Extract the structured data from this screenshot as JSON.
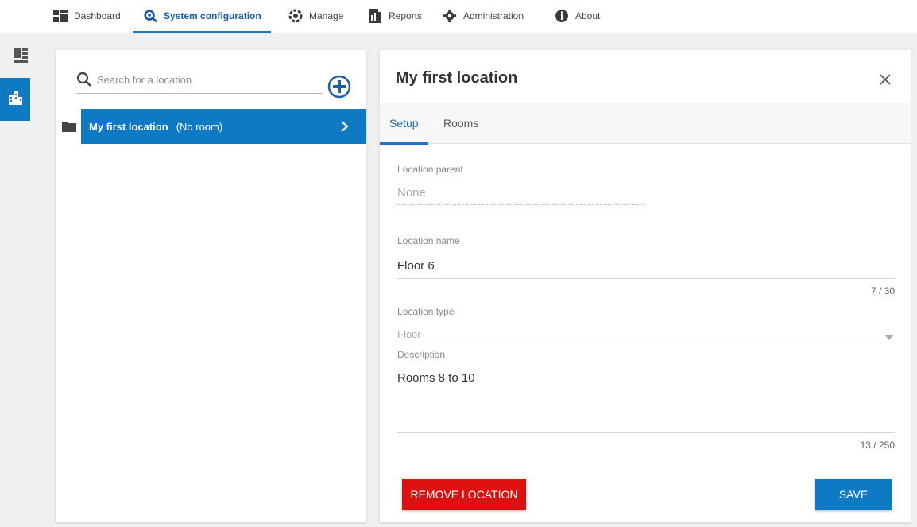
{
  "nav": {
    "items": [
      {
        "label": "Dashboard",
        "icon": "dashboard-icon"
      },
      {
        "label": "System configuration",
        "icon": "system-configuration-icon"
      },
      {
        "label": "Manage",
        "icon": "manage-icon"
      },
      {
        "label": "Reports",
        "icon": "reports-icon"
      },
      {
        "label": "Administration",
        "icon": "administration-icon"
      },
      {
        "label": "About",
        "icon": "about-icon"
      }
    ],
    "active": "System configuration"
  },
  "siderail": {
    "items": [
      {
        "icon": "devices-icon"
      },
      {
        "icon": "buildings-icon"
      }
    ]
  },
  "locations": {
    "search_placeholder": "Search for a location",
    "add_icon": "add-circle-icon",
    "rows": [
      {
        "name": "My first location",
        "detail": "(No room)"
      }
    ]
  },
  "detail": {
    "title": "My first location",
    "tabs": [
      {
        "label": "Setup"
      },
      {
        "label": "Rooms"
      }
    ],
    "active_tab": "Setup",
    "fields": {
      "parent_label": "Location parent",
      "parent_value": "None",
      "name_label": "Location name",
      "name_value": "Floor 6",
      "name_counter": "7 / 30",
      "type_label": "Location type",
      "type_value": "Floor",
      "description_label": "Description",
      "description_value": "Rooms 8 to 10",
      "description_counter": "13 / 250"
    },
    "buttons": {
      "remove": "REMOVE LOCATION",
      "save": "SAVE"
    }
  },
  "colors": {
    "accent": "#0e7ac3",
    "danger": "#dc1111",
    "nav_active_text": "#1a5fa3"
  }
}
